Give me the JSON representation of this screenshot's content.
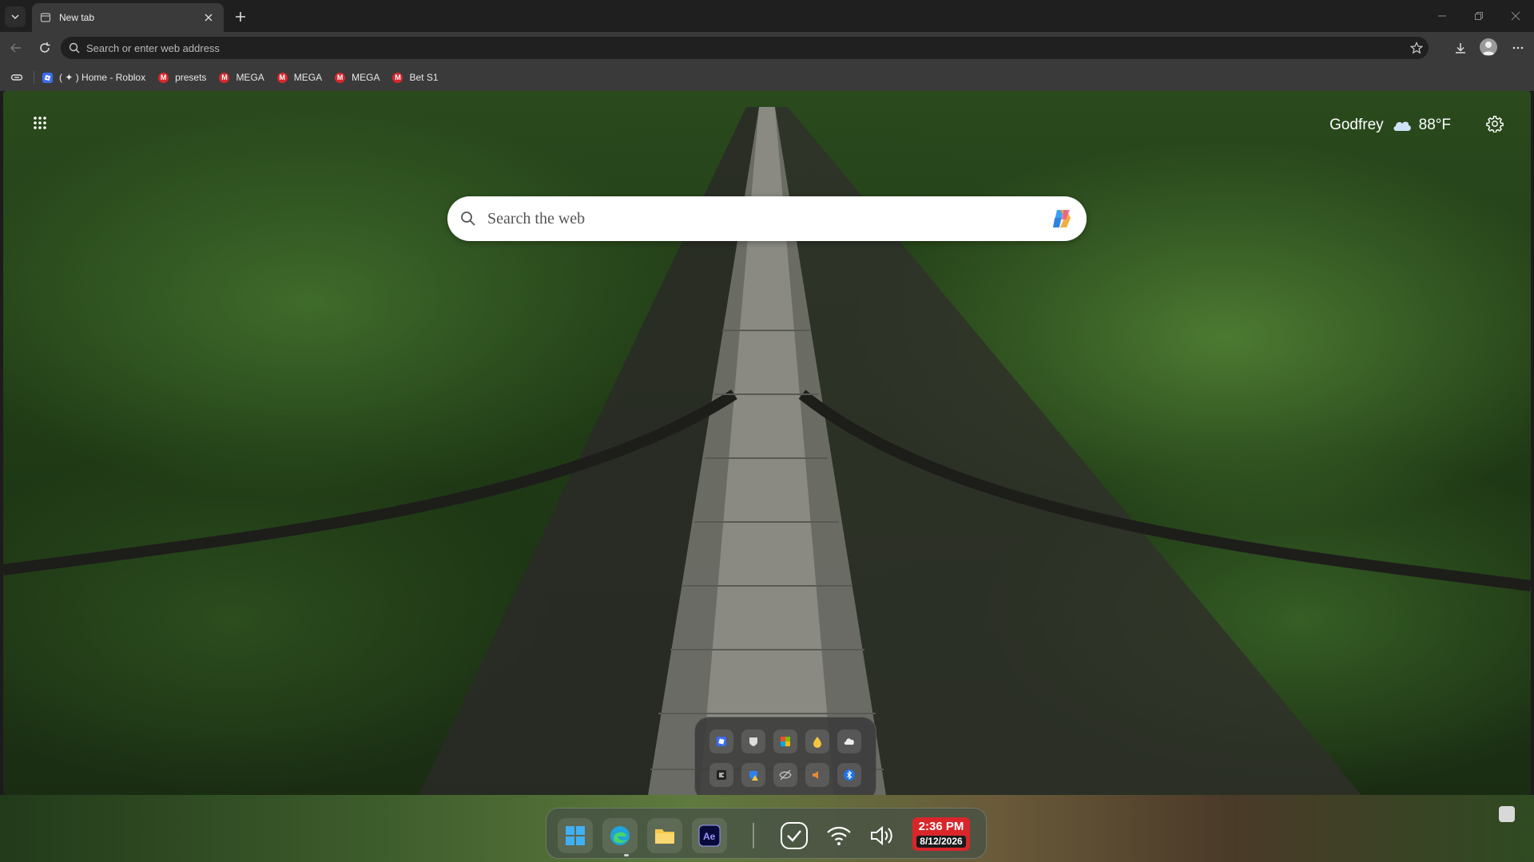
{
  "browser": {
    "tab": {
      "title": "New tab"
    },
    "address_bar": {
      "placeholder": "Search or enter web address"
    },
    "bookmarks": [
      {
        "label": "( ✦ ) Home - Roblox",
        "icon": "roblox-icon"
      },
      {
        "label": "presets",
        "icon": "mega-icon"
      },
      {
        "label": "MEGA",
        "icon": "mega-icon"
      },
      {
        "label": "MEGA",
        "icon": "mega-icon"
      },
      {
        "label": "MEGA",
        "icon": "mega-icon"
      },
      {
        "label": "Bet S1",
        "icon": "mega-icon"
      }
    ]
  },
  "newtab": {
    "user_name": "Godfrey",
    "weather": {
      "temperature": "88°F",
      "icon": "cloud-icon"
    },
    "search": {
      "placeholder": "Search the web"
    }
  },
  "taskbar": {
    "clock": {
      "time": "2:36 PM",
      "date": "8/12/2026"
    }
  },
  "colors": {
    "browser_chrome": "#3a3a3a",
    "tabstrip": "#1f1f1f",
    "clock_accent": "#d8262b",
    "mega_red": "#d9272e"
  }
}
